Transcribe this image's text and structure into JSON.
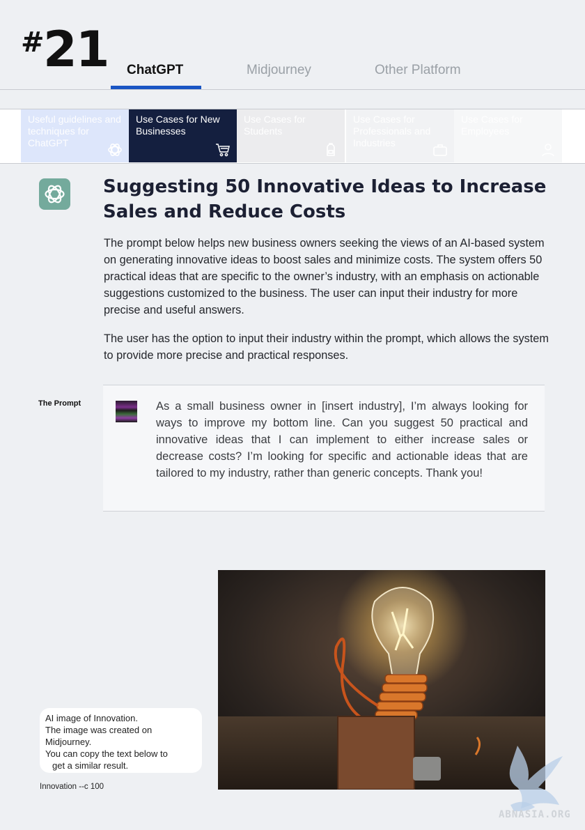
{
  "header": {
    "page_hash": "#",
    "page_number": "21",
    "tabs": [
      {
        "label": "ChatGPT",
        "active": true
      },
      {
        "label": "Midjourney",
        "active": false
      },
      {
        "label": "Other Platform",
        "active": false
      }
    ]
  },
  "categories": [
    {
      "label": "Useful guidelines and techniques for ChatGPT",
      "icon": "openai-logo-icon"
    },
    {
      "label": "Use Cases for New Businesses",
      "icon": "cart-icon",
      "active": true
    },
    {
      "label": "Use Cases for Students",
      "icon": "backpack-icon"
    },
    {
      "label": "Use Cases for Professionals and Industries",
      "icon": "briefcase-icon"
    },
    {
      "label": "Use Cases for Employees",
      "icon": "person-icon"
    }
  ],
  "article": {
    "title": "Suggesting 50 Innovative Ideas to Increase Sales and Reduce Costs",
    "paragraph1": "The prompt below helps new business owners seeking the views of an AI-based system on generating innovative ideas to boost sales and minimize costs. The system offers 50 practical ideas that are specific to the owner’s industry, with an emphasis on actionable suggestions customized to the business. The user can input their industry for more precise and useful answers.",
    "paragraph2": "The user has the option to input their industry within the prompt, which allows the system to provide more precise and practical responses."
  },
  "prompt": {
    "label": "The Prompt",
    "text": "As a small business owner in [insert industry], I’m always looking for ways to improve my bottom line. Can you suggest 50 practical and innovative ideas that I can implement to either increase sales or decrease costs? I’m looking for specific and actionable ideas that are tailored to my industry, rather than generic concepts. Thank you!"
  },
  "image_section": {
    "caption_lines": [
      "AI image of Innovation.",
      "The image was created on",
      "Midjourney.",
      "You can copy the text below to",
      "get a similar result."
    ],
    "midjourney_prompt": "Innovation --c 100"
  },
  "watermark": "ABNASIA.ORG",
  "colors": {
    "accent_blue": "#1a56c4",
    "active_category": "#141f3f",
    "chatgpt_green": "#74aa9c"
  }
}
